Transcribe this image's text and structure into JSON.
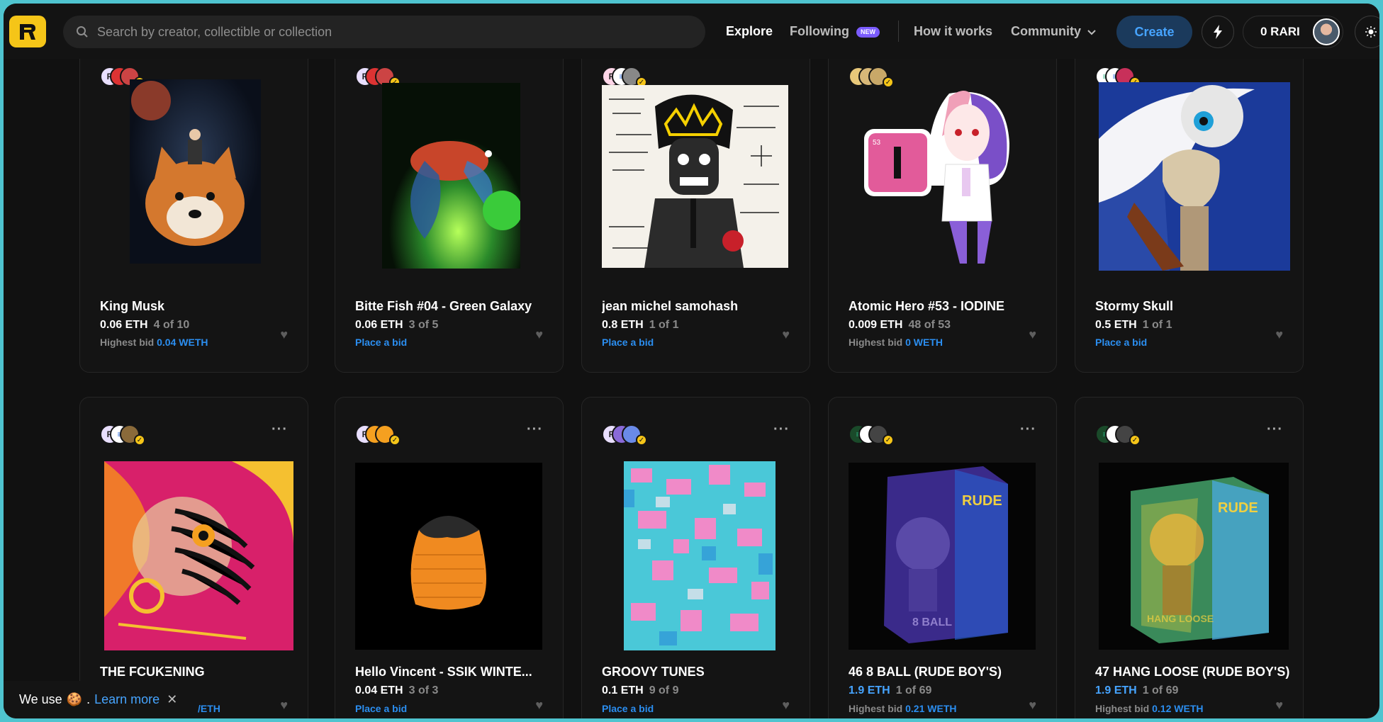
{
  "header": {
    "search_placeholder": "Search by creator, collectible or collection",
    "nav": {
      "explore": "Explore",
      "following": "Following",
      "following_badge": "NEW",
      "how_it_works": "How it works",
      "community": "Community"
    },
    "create_label": "Create",
    "balance": "0 RARI"
  },
  "cards": [
    {
      "title": "King Musk",
      "price": "0.06 ETH",
      "editions": "4 of 10",
      "bid_prefix": "Highest bid",
      "bid_value": "0.04 WETH"
    },
    {
      "title": "Bitte Fish #04 - Green Galaxy",
      "price": "0.06 ETH",
      "editions": "3 of 5",
      "bid_label": "Place a bid"
    },
    {
      "title": "jean michel samohash",
      "price": "0.8 ETH",
      "editions": "1 of 1",
      "bid_label": "Place a bid"
    },
    {
      "title": "Atomic Hero #53 - IODINE",
      "price": "0.009 ETH",
      "editions": "48 of 53",
      "bid_prefix": "Highest bid",
      "bid_value": "0 WETH"
    },
    {
      "title": "Stormy Skull",
      "price": "0.5 ETH",
      "editions": "1 of 1",
      "bid_label": "Place a bid"
    },
    {
      "title": "THE FCUKΞNING",
      "price": "",
      "editions": "",
      "bid_value": "/ETH"
    },
    {
      "title": "Hello Vincent - SSIK WINTE...",
      "price": "0.04 ETH",
      "editions": "3 of 3",
      "bid_label": "Place a bid"
    },
    {
      "title": "GROOVY TUNES",
      "price": "0.1 ETH",
      "editions": "9 of 9",
      "bid_label": "Place a bid"
    },
    {
      "title": "46 8 BALL (RUDE BOY'S)",
      "price": "1.9 ETH",
      "editions": "1 of 69",
      "bid_prefix": "Highest bid",
      "bid_value": "0.21 WETH"
    },
    {
      "title": "47 HANG LOOSE (RUDE BOY'S)",
      "price": "1.9 ETH",
      "editions": "1 of 69",
      "bid_prefix": "Highest bid",
      "bid_value": "0.12 WETH"
    }
  ],
  "cookie": {
    "text": "We use",
    "emoji": "🍪",
    "dot": ".",
    "learn_more": "Learn more",
    "close": "✕"
  },
  "colors": {
    "accent_blue": "#46a4ff",
    "logo_yellow": "#f5c518",
    "frame_border": "#4fc4cf"
  }
}
